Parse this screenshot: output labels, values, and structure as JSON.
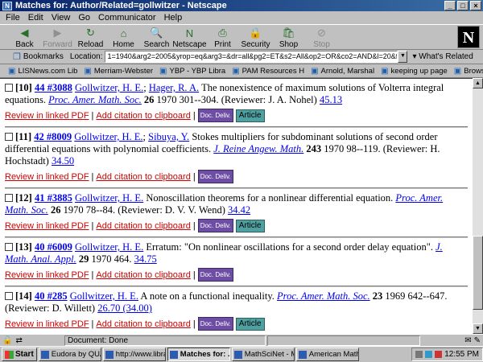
{
  "window": {
    "title": "Matches for: Author/Related=gollwitzer - Netscape"
  },
  "menu": [
    "File",
    "Edit",
    "View",
    "Go",
    "Communicator",
    "Help"
  ],
  "toolbar": [
    {
      "label": "Back",
      "icon": "back-arrow-icon",
      "enabled": true
    },
    {
      "label": "Forward",
      "icon": "forward-arrow-icon",
      "enabled": false
    },
    {
      "label": "Reload",
      "icon": "reload-icon",
      "enabled": true
    },
    {
      "label": "Home",
      "icon": "home-icon",
      "enabled": true
    },
    {
      "label": "Search",
      "icon": "search-icon",
      "enabled": true
    },
    {
      "label": "Netscape",
      "icon": "netscape-icon",
      "enabled": true
    },
    {
      "label": "Print",
      "icon": "print-icon",
      "enabled": true
    },
    {
      "label": "Security",
      "icon": "security-icon",
      "enabled": true
    },
    {
      "label": "Shop",
      "icon": "shop-icon",
      "enabled": true
    },
    {
      "label": "Stop",
      "icon": "stop-icon",
      "enabled": false
    }
  ],
  "location": {
    "bookmarks_label": "Bookmarks",
    "label": "Location:",
    "url": "1=1940&arg2=2005&yrop=eq&arg3=&dr=all&pg2=ET&s2=All&op2=OR&co2=AND&l=20&fn=130&r=1",
    "related_label": "What's Related"
  },
  "personal_toolbar": [
    "LISNews.com Lib",
    "Merriam-Webster",
    "YBP - YBP Libra",
    "PAM Resources H",
    "Arnold, Marshal",
    "keeping up page",
    "Browser Stuff"
  ],
  "entries": [
    {
      "num": "[10]",
      "mr": "44 #3088",
      "authors": [
        "Gollwitzer, H. E.",
        "Hager, R. A."
      ],
      "title": "The nonexistence of maximum solutions of Volterra integral equations.",
      "journal": "Proc. Amer. Math. Soc.",
      "volume": "26",
      "details": "1970 301--304. (Reviewer: J. A. Nohel)",
      "review": "45.13",
      "article": true
    },
    {
      "num": "[11]",
      "mr": "42 #8009",
      "authors": [
        "Gollwitzer, H. E.",
        "Sibuya, Y."
      ],
      "title": "Stokes multipliers for subdominant solutions of second order differential equations with polynomial coefficients.",
      "journal": "J. Reine Angew. Math.",
      "volume": "243",
      "details": "1970 98--119. (Reviewer: H. Hochstadt)",
      "review": "34.50",
      "article": false
    },
    {
      "num": "[12]",
      "mr": "41 #3885",
      "authors": [
        "Gollwitzer, H. E."
      ],
      "title": "Nonoscillation theorems for a nonlinear differential equation.",
      "journal": "Proc. Amer. Math. Soc.",
      "volume": "26",
      "details": "1970 78--84. (Reviewer: D. V. V. Wend)",
      "review": "34.42",
      "article": true
    },
    {
      "num": "[13]",
      "mr": "40 #6009",
      "authors": [
        "Gollwitzer, H. E."
      ],
      "title": "Erratum: \"On nonlinear oscillations for a second order delay equation\".",
      "journal": "J. Math. Anal. Appl.",
      "volume": "29",
      "details": "1970 464.",
      "review": "34.75",
      "article": false
    },
    {
      "num": "[14]",
      "mr": "40 #285",
      "authors": [
        "Gollwitzer, H. E."
      ],
      "title": "A note on a functional inequality.",
      "journal": "Proc. Amer. Math. Soc.",
      "volume": "23",
      "details": "1969 642--647. (Reviewer: D. Willett)",
      "review": "26.70 (34.00)",
      "article": true
    }
  ],
  "actions": {
    "review_pdf": "Review in linked PDF",
    "citation": "Add citation to clipboard",
    "doc_deliv": "Doc. Deliv.",
    "article": "Article"
  },
  "status": {
    "text": "Document: Done"
  },
  "taskbar": {
    "start": "Start",
    "tasks": [
      {
        "label": "Eudora by QUAL...",
        "active": false
      },
      {
        "label": "http://www.librar...",
        "active": false
      },
      {
        "label": "Matches for: ...",
        "active": true
      },
      {
        "label": "MathSciNet - Mi...",
        "active": false
      },
      {
        "label": "American Mathe...",
        "active": false
      }
    ],
    "clock": "12:55 PM"
  }
}
